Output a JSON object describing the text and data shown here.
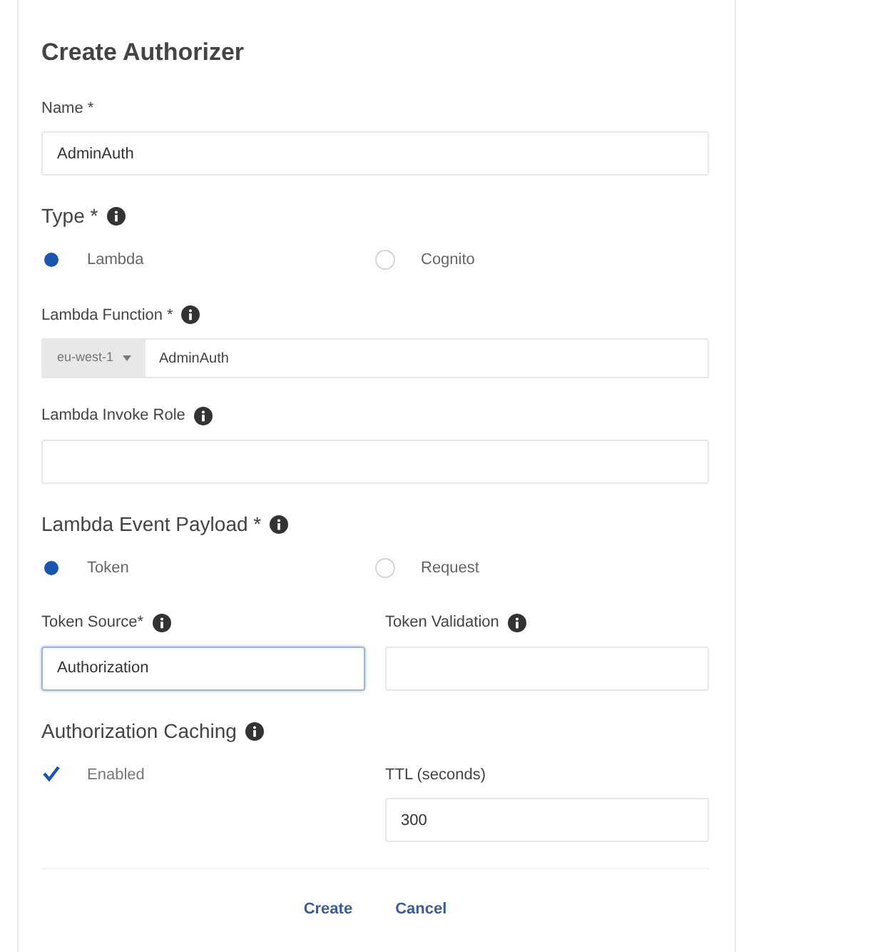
{
  "title": "Create Authorizer",
  "fields": [
    {
      "kind": "text",
      "label": "Name *",
      "info": false,
      "value": "AdminAuth"
    },
    {
      "kind": "radio",
      "label": "Type *",
      "info": true,
      "options": [
        {
          "label": "Lambda",
          "selected": true
        },
        {
          "label": "Cognito",
          "selected": false
        }
      ]
    },
    {
      "kind": "region_text",
      "label": "Lambda Function *",
      "info": true,
      "region": "eu-west-1",
      "value": "AdminAuth"
    },
    {
      "kind": "text",
      "label": "Lambda Invoke Role",
      "info": true
    },
    {
      "kind": "radio",
      "label": "Lambda Event Payload *",
      "info": true,
      "options": [
        {
          "label": "Token",
          "selected": true
        },
        {
          "label": "Request",
          "selected": false
        }
      ]
    },
    {
      "kind": "pair",
      "columns": [
        {
          "label": "Token Source*",
          "info": true,
          "value": "Authorization",
          "focused": true
        },
        {
          "label": "Token Validation",
          "info": true,
          "focused": false
        }
      ]
    },
    {
      "kind": "caching",
      "label": "Authorization Caching",
      "info": true,
      "checkbox": {
        "label": "Enabled",
        "checked": true
      },
      "ttl": {
        "label": "TTL (seconds)",
        "value": "300"
      }
    }
  ],
  "buttons": [
    {
      "label": "Create"
    },
    {
      "label": "Cancel"
    }
  ]
}
